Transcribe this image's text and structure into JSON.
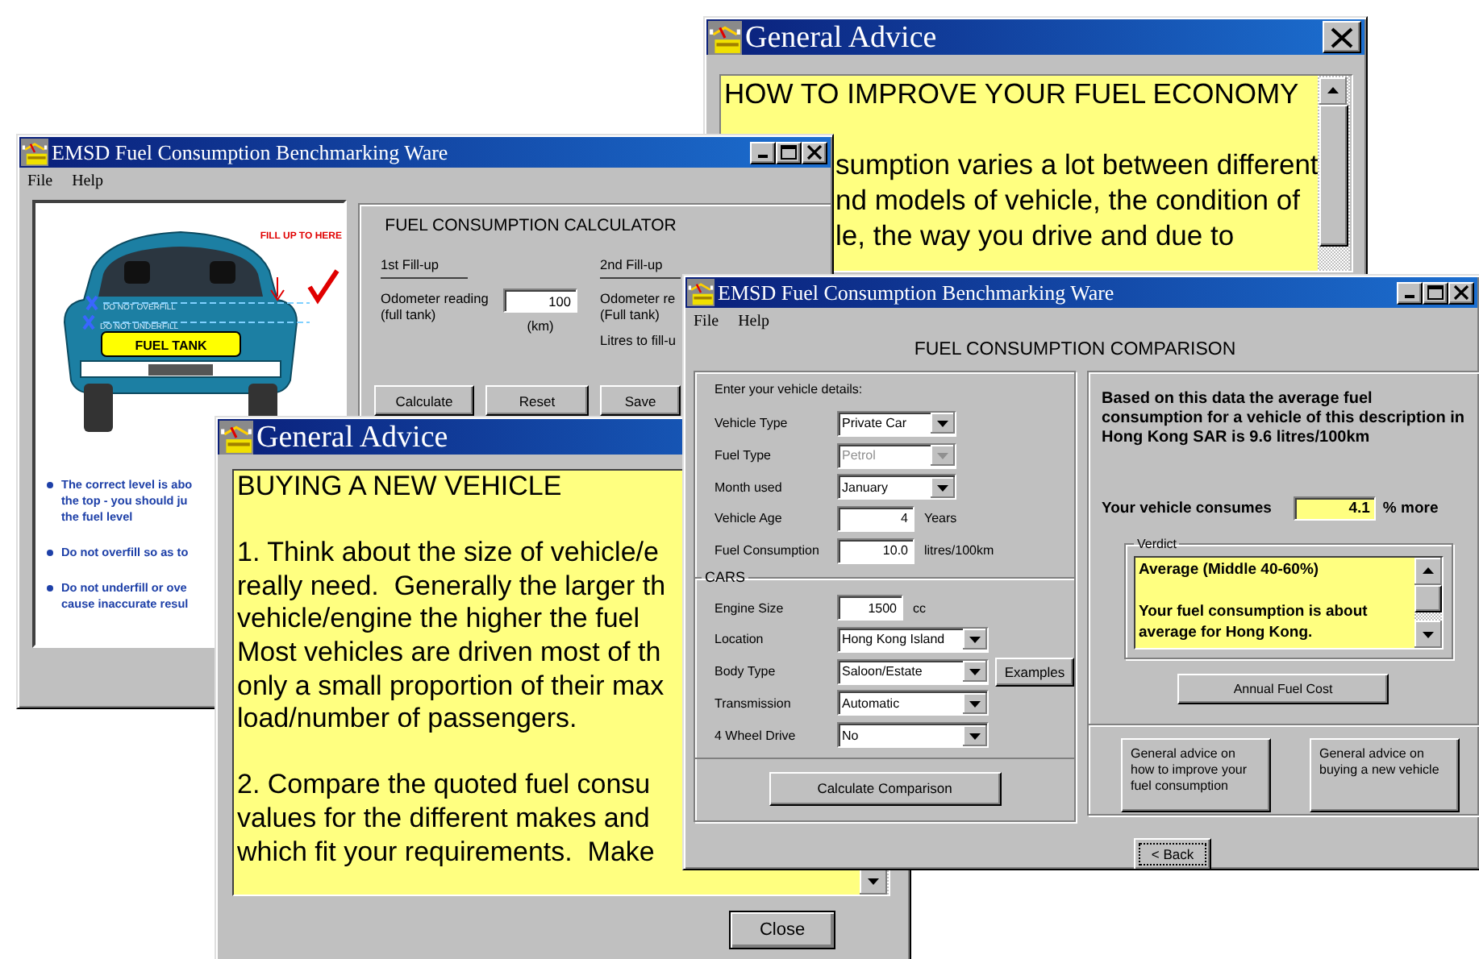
{
  "economy_advice": {
    "title": "General Advice",
    "heading": "HOW TO IMPROVE YOUR FUEL ECONOMY",
    "lines": [
      "sumption varies a lot between different",
      "nd models of vehicle, the condition of",
      "le, the way you drive and due to"
    ]
  },
  "calculator": {
    "title": "EMSD Fuel Consumption Benchmarking Ware",
    "menu": [
      "File",
      "Help"
    ],
    "illustration": {
      "fill_label": "FILL UP TO HERE",
      "overfill_label": "DO NOT OVERFILL",
      "underfill_label": "DO NOT UNDERFILL",
      "tank_label": "FUEL TANK"
    },
    "tips": [
      {
        "lines": [
          "The correct level is abo",
          "the top - you should ju",
          "the fuel level"
        ]
      },
      {
        "lines": [
          "Do not overfill so as to"
        ]
      },
      {
        "lines": [
          "Do not underfill or ove",
          "cause inaccurate resul"
        ]
      }
    ],
    "heading": "FUEL CONSUMPTION CALCULATOR",
    "first_fillup": {
      "title": "1st Fill-up",
      "odometer_label": "Odometer reading",
      "tank_label": "(full tank)",
      "value": "100",
      "unit": "(km)"
    },
    "second_fillup": {
      "title": "2nd Fill-up",
      "odometer_label": "Odometer re",
      "tank_label": "(Full tank)",
      "litres_label": "Litres to fill-u"
    },
    "buttons": [
      "Calculate",
      "Reset",
      "Save"
    ]
  },
  "buying_advice": {
    "title": "General Advice",
    "paragraphs": [
      [
        "BUYING A NEW VEHICLE"
      ],
      [
        "1. Think about the size of vehicle/e",
        "really need.  Generally the larger th",
        "vehicle/engine the higher the fuel",
        "Most vehicles are driven most of th",
        "only a small proportion of their max",
        "load/number of passengers."
      ],
      [
        "2. Compare the quoted fuel consu",
        "values for the different makes and",
        "which fit your requirements.  Make"
      ]
    ],
    "close_button": "Close"
  },
  "comparison": {
    "title": "EMSD Fuel Consumption Benchmarking Ware",
    "menu": [
      "File",
      "Help"
    ],
    "heading": "FUEL CONSUMPTION COMPARISON",
    "details_label": "Enter your vehicle details:",
    "vehicle_fields": [
      {
        "label": "Vehicle Type",
        "kind": "dropdown",
        "value": "Private Car",
        "disabled": false
      },
      {
        "label": "Fuel Type",
        "kind": "dropdown",
        "value": "Petrol",
        "disabled": true
      },
      {
        "label": "Month used",
        "kind": "dropdown",
        "value": "January",
        "disabled": false
      },
      {
        "label": "Vehicle Age",
        "kind": "input",
        "value": "4",
        "unit": "Years",
        "disabled": false
      },
      {
        "label": "Fuel Consumption",
        "kind": "input",
        "value": "10.0",
        "unit": "litres/100km",
        "disabled": false
      }
    ],
    "cars_label": "CARS",
    "car_fields": [
      {
        "label": "Engine Size",
        "kind": "input",
        "value": "1500",
        "unit": "cc",
        "disabled": false
      },
      {
        "label": "Location",
        "kind": "dropdown",
        "value": "Hong Kong Island",
        "disabled": false
      },
      {
        "label": "Body Type",
        "kind": "dropdown",
        "value": "Saloon/Estate",
        "button": "Examples",
        "disabled": false
      },
      {
        "label": "Transmission",
        "kind": "dropdown",
        "value": "Automatic",
        "disabled": false
      },
      {
        "label": "4 Wheel Drive",
        "kind": "dropdown",
        "value": "No",
        "disabled": false
      }
    ],
    "calculate_button": "Calculate Comparison",
    "summary": "Based on this data the average fuel consumption for a vehicle of this description in Hong Kong SAR is 9.6 litres/100km",
    "consumes_label": "Your vehicle consumes",
    "consumes_value": "4.1",
    "consumes_unit": "% more",
    "verdict": {
      "label": "Verdict",
      "rating": "Average (Middle 40-60%)",
      "message": "Your fuel consumption is about average for Hong Kong."
    },
    "annual_button": "Annual Fuel Cost",
    "advice_buttons": [
      "General advice on how to improve your fuel consumption",
      "General advice on buying a new vehicle"
    ],
    "back_button": "< Back"
  }
}
